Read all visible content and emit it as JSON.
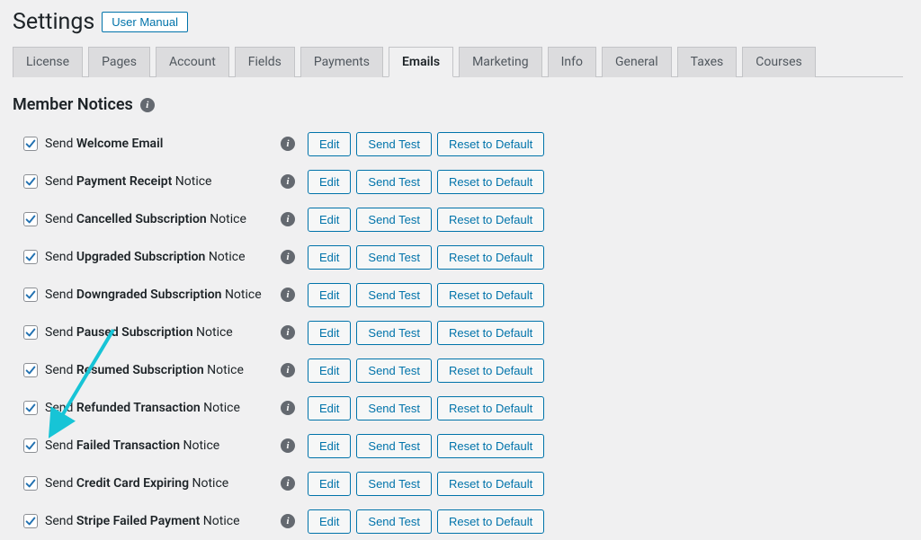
{
  "header": {
    "title": "Settings",
    "user_manual_label": "User Manual"
  },
  "tabs": {
    "items": [
      {
        "label": "License"
      },
      {
        "label": "Pages"
      },
      {
        "label": "Account"
      },
      {
        "label": "Fields"
      },
      {
        "label": "Payments"
      },
      {
        "label": "Emails"
      },
      {
        "label": "Marketing"
      },
      {
        "label": "Info"
      },
      {
        "label": "General"
      },
      {
        "label": "Taxes"
      },
      {
        "label": "Courses"
      }
    ],
    "active_index": 5
  },
  "section": {
    "heading": "Member Notices"
  },
  "buttons": {
    "edit": "Edit",
    "send_test": "Send Test",
    "reset": "Reset to Default"
  },
  "notices": [
    {
      "prefix": "Send ",
      "bold": "Welcome Email",
      "suffix": "",
      "checked": true
    },
    {
      "prefix": "Send ",
      "bold": "Payment Receipt",
      "suffix": " Notice",
      "checked": true
    },
    {
      "prefix": "Send ",
      "bold": "Cancelled Subscription",
      "suffix": " Notice",
      "checked": true
    },
    {
      "prefix": "Send ",
      "bold": "Upgraded Subscription",
      "suffix": " Notice",
      "checked": true
    },
    {
      "prefix": "Send ",
      "bold": "Downgraded Subscription",
      "suffix": " Notice",
      "checked": true
    },
    {
      "prefix": "Send ",
      "bold": "Paused Subscription",
      "suffix": " Notice",
      "checked": true
    },
    {
      "prefix": "Send ",
      "bold": "Resumed Subscription",
      "suffix": " Notice",
      "checked": true
    },
    {
      "prefix": "Send ",
      "bold": "Refunded Transaction",
      "suffix": " Notice",
      "checked": true
    },
    {
      "prefix": "Send ",
      "bold": "Failed Transaction",
      "suffix": " Notice",
      "checked": true
    },
    {
      "prefix": "Send ",
      "bold": "Credit Card Expiring",
      "suffix": " Notice",
      "checked": true
    },
    {
      "prefix": "Send ",
      "bold": "Stripe Failed Payment",
      "suffix": " Notice",
      "checked": true
    }
  ],
  "colors": {
    "accent": "#0073aa",
    "arrow": "#17c4d6"
  }
}
